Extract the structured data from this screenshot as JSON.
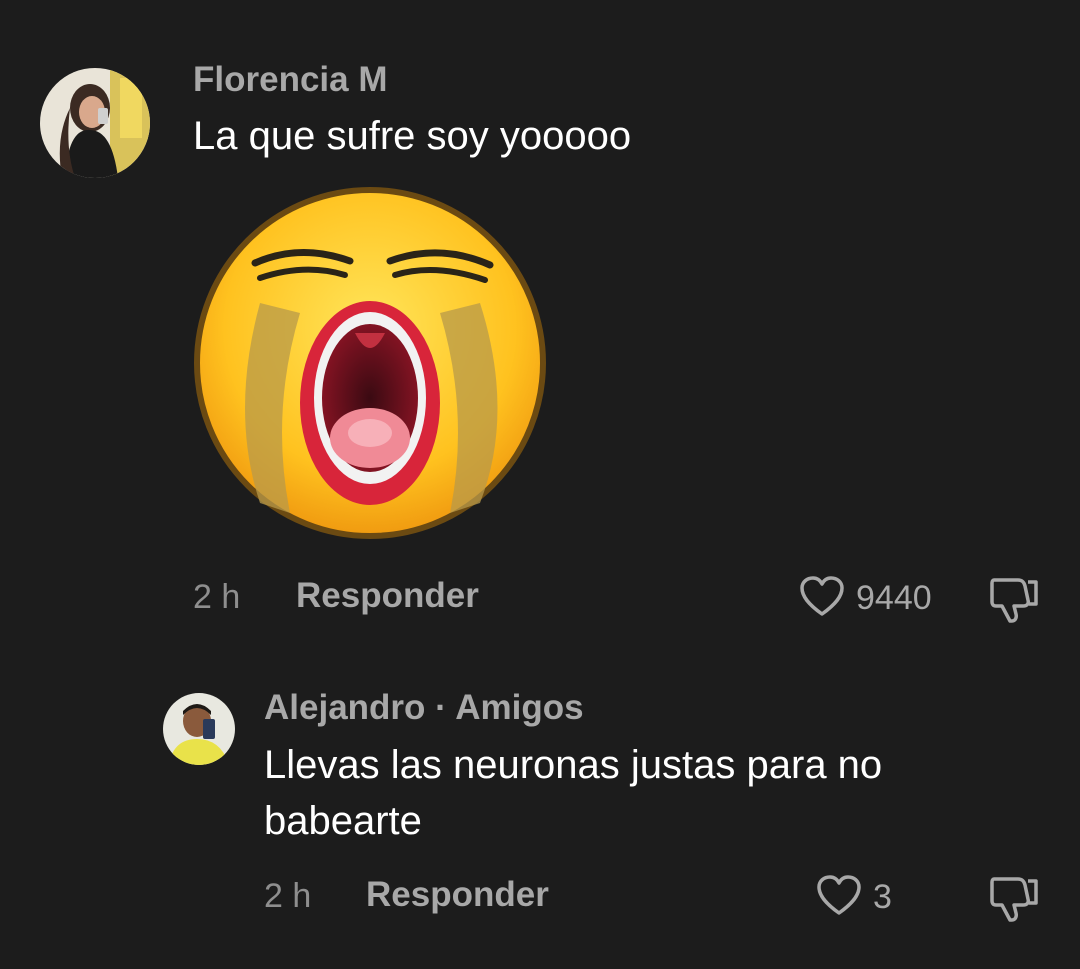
{
  "comments": [
    {
      "username": "Florencia M",
      "text": "La que sufre soy yooooo",
      "time": "2 h",
      "reply_label": "Responder",
      "likes": "9440",
      "sticker": "crying-face-sticker"
    },
    {
      "username": "Alejandro",
      "separator": "·",
      "badge": "Amigos",
      "text_line1": "Llevas las neuronas justas para no",
      "text_line2": "babearte",
      "time": "2 h",
      "reply_label": "Responder",
      "likes": "3"
    }
  ],
  "colors": {
    "background": "#1c1c1c",
    "username": "#a8a8a8",
    "text": "#ffffff",
    "meta": "#8e8e8e"
  },
  "icons": {
    "like": "heart-outline-icon",
    "dislike": "thumbs-down-icon"
  }
}
